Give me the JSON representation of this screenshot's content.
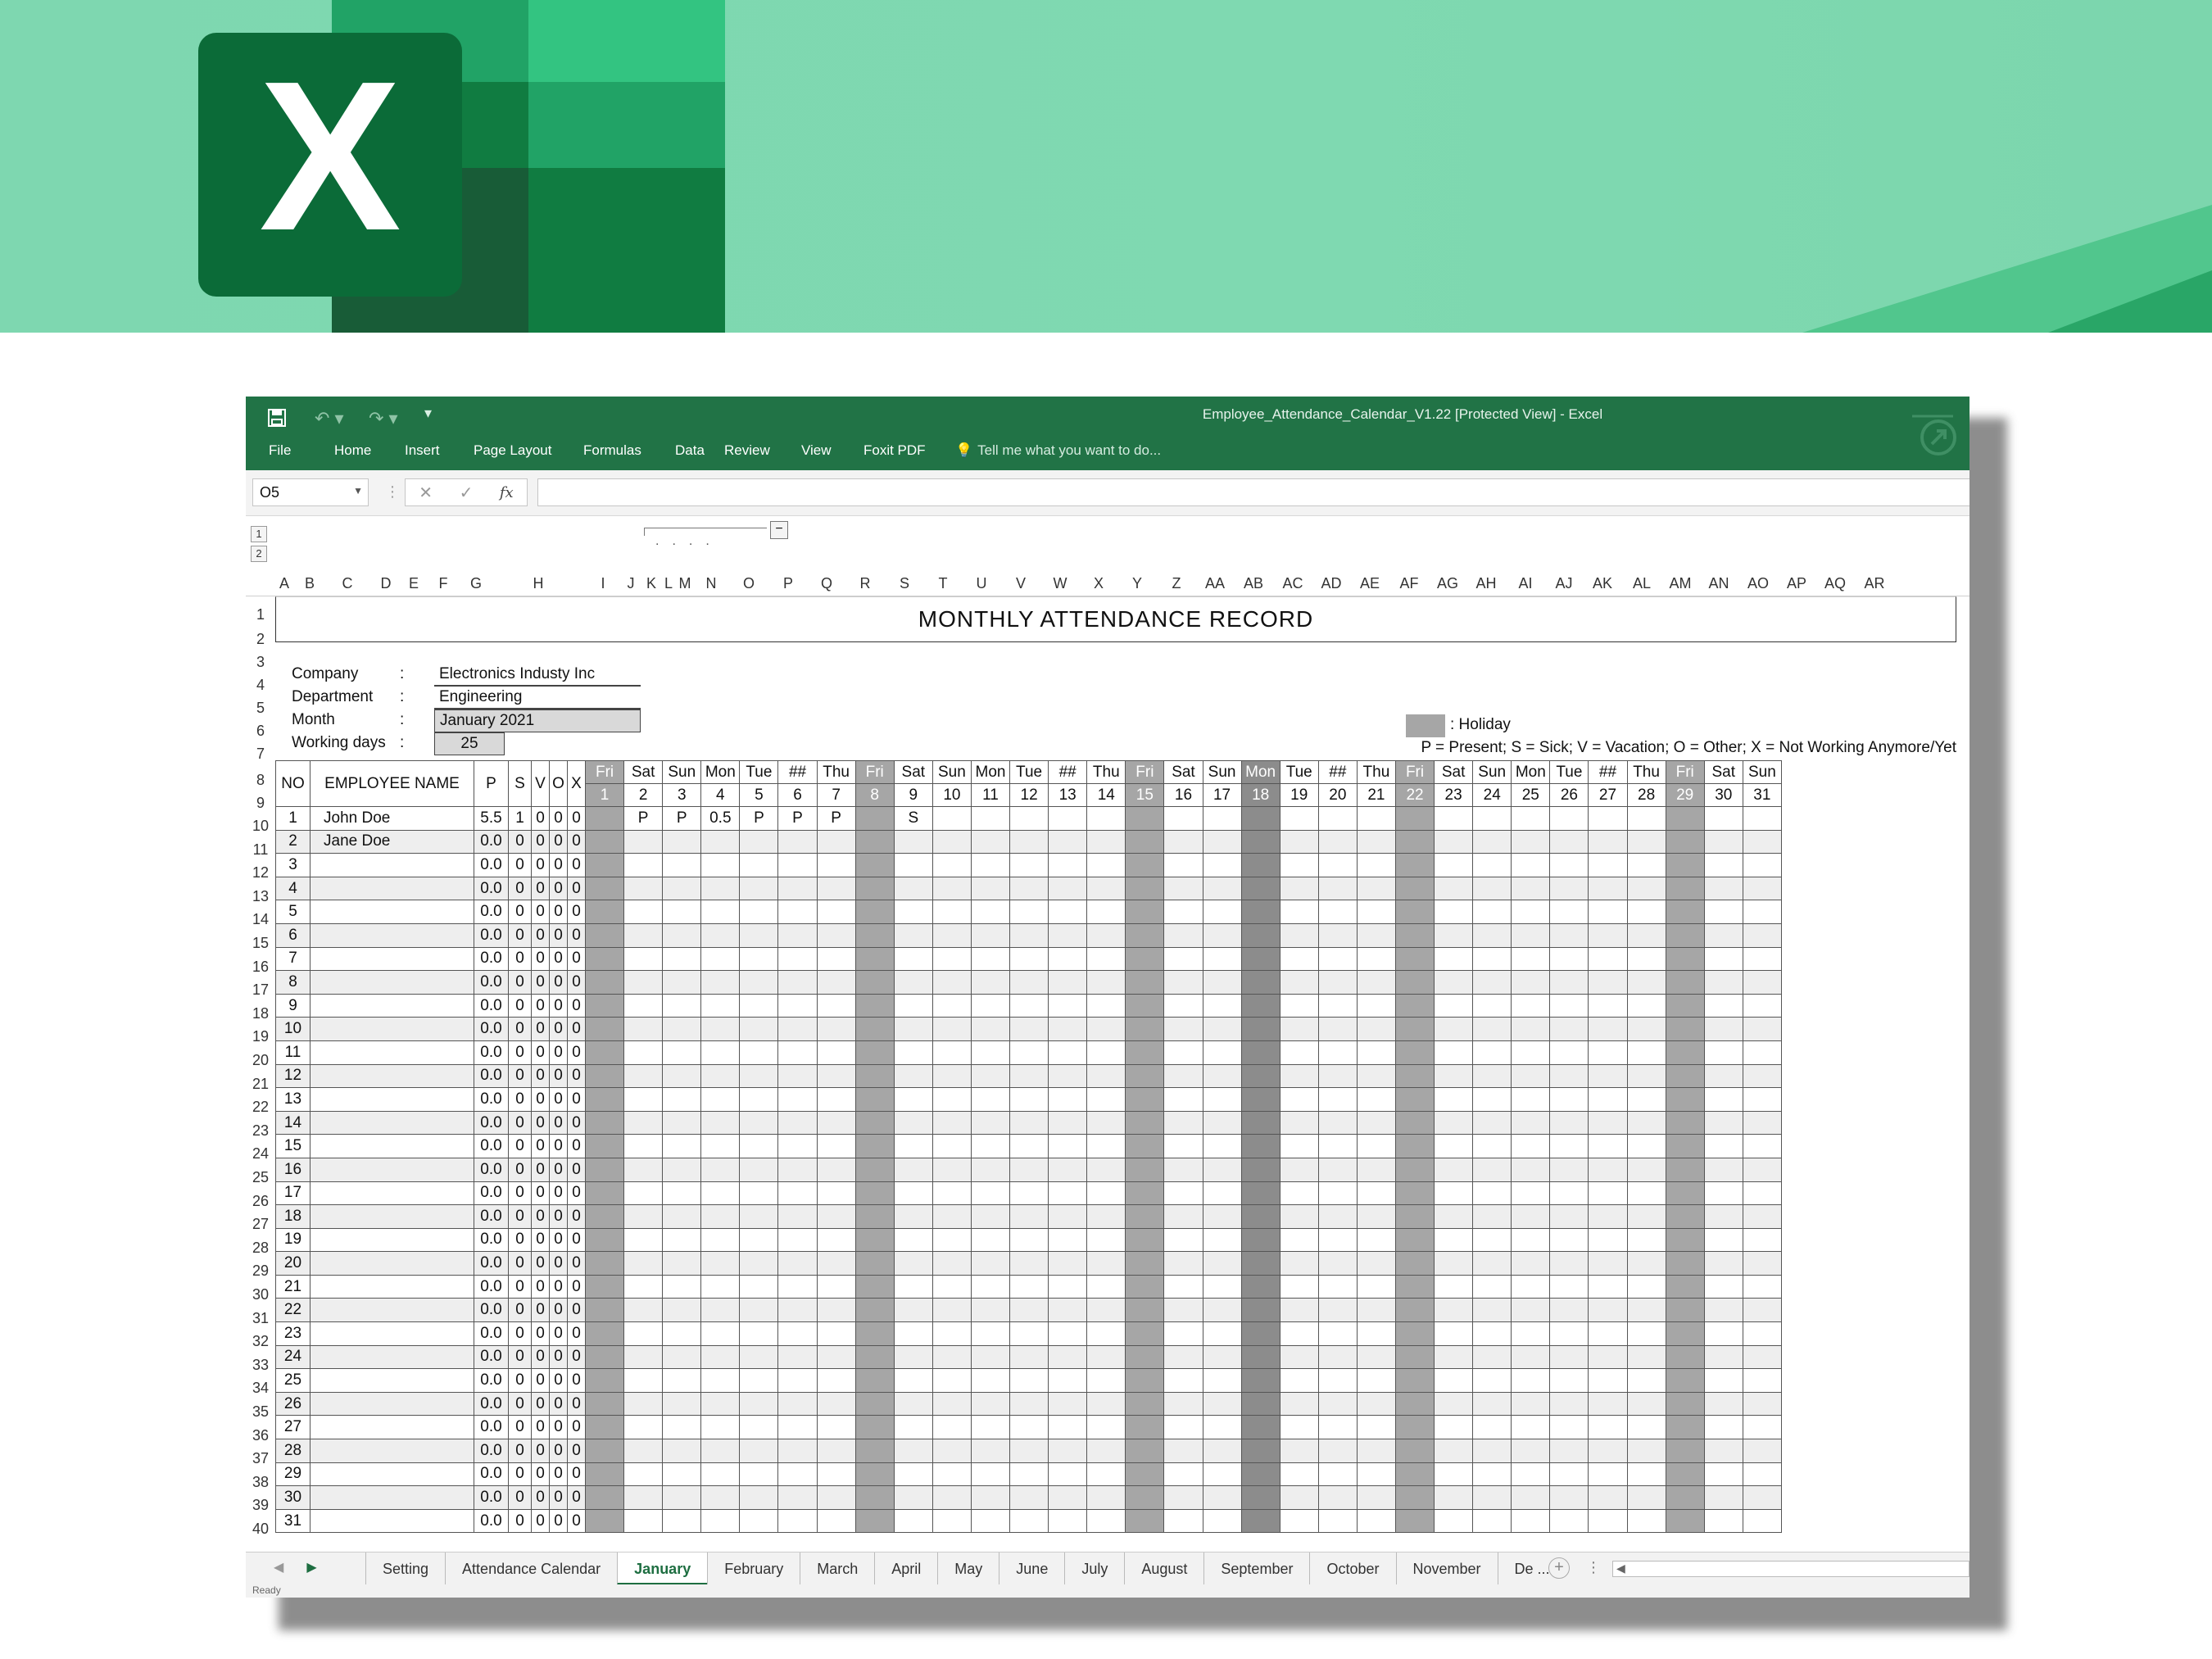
{
  "banner": {
    "logo_letter": "X"
  },
  "titlebar": {
    "title": "Employee_Attendance_Calendar_V1.22  [Protected View] - Excel",
    "tabs": [
      "File",
      "Home",
      "Insert",
      "Page Layout",
      "Formulas",
      "Data",
      "Review",
      "View",
      "Foxit PDF"
    ],
    "tellme": "Tell me what you want to do...",
    "icons": [
      "save-icon",
      "undo-icon",
      "redo-icon",
      "customize-qat-icon",
      "lightbulb-icon"
    ]
  },
  "formulabar": {
    "namebox": "O5",
    "cancel": "✕",
    "enter": "✓",
    "fx": "fx",
    "value": ""
  },
  "outline": {
    "level1": "1",
    "level2": "2",
    "collapse": "−"
  },
  "columns": [
    "A",
    "B",
    "C",
    "D",
    "E",
    "F",
    "G",
    "H",
    "I",
    "J",
    "K",
    "L",
    "M",
    "N",
    "O",
    "P",
    "Q",
    "R",
    "S",
    "T",
    "U",
    "V",
    "W",
    "X",
    "Y",
    "Z",
    "AA",
    "AB",
    "AC",
    "AD",
    "AE",
    "AF",
    "AG",
    "AH",
    "AI",
    "AJ",
    "AK",
    "AL",
    "AM",
    "AN",
    "AO",
    "AP",
    "AQ",
    "AR"
  ],
  "rows": [
    "1",
    "2",
    "3",
    "4",
    "5",
    "6",
    "7",
    "8",
    "9",
    "10",
    "11",
    "12",
    "13",
    "14",
    "15",
    "16",
    "17",
    "18",
    "19",
    "20",
    "21",
    "22",
    "23",
    "24",
    "25",
    "26",
    "27",
    "28",
    "29",
    "30",
    "31",
    "32",
    "33",
    "34",
    "35",
    "36",
    "37",
    "38",
    "39",
    "40"
  ],
  "sheet": {
    "title": "MONTHLY ATTENDANCE RECORD",
    "info": [
      {
        "label": "Company",
        "colon": ":",
        "value": "Electronics Industy Inc"
      },
      {
        "label": "Department",
        "colon": ":",
        "value": "Engineering"
      },
      {
        "label": "Month",
        "colon": ":",
        "value": "January  2021"
      },
      {
        "label": "Working days",
        "colon": ":",
        "value": "25"
      }
    ],
    "legend_holiday": ": Holiday",
    "legend_codes": "P = Present; S = Sick;  V = Vacation; O = Other; X = Not Working Anymore/Yet",
    "colors": {
      "holiday": "#a6a6a6",
      "holiday_dark": "#8c8c8c",
      "accent": "#217346"
    }
  },
  "table": {
    "headers": {
      "no": "NO",
      "name": "EMPLOYEE NAME",
      "p": "P",
      "s": "S",
      "v": "V",
      "o": "O",
      "x": "X"
    },
    "days": [
      {
        "dow": "Fri",
        "d": "1",
        "hol": true
      },
      {
        "dow": "Sat",
        "d": "2"
      },
      {
        "dow": "Sun",
        "d": "3"
      },
      {
        "dow": "Mon",
        "d": "4"
      },
      {
        "dow": "Tue",
        "d": "5"
      },
      {
        "dow": "##",
        "d": "6"
      },
      {
        "dow": "Thu",
        "d": "7"
      },
      {
        "dow": "Fri",
        "d": "8",
        "hol": true
      },
      {
        "dow": "Sat",
        "d": "9"
      },
      {
        "dow": "Sun",
        "d": "10"
      },
      {
        "dow": "Mon",
        "d": "11"
      },
      {
        "dow": "Tue",
        "d": "12"
      },
      {
        "dow": "##",
        "d": "13"
      },
      {
        "dow": "Thu",
        "d": "14"
      },
      {
        "dow": "Fri",
        "d": "15",
        "hol": true
      },
      {
        "dow": "Sat",
        "d": "16"
      },
      {
        "dow": "Sun",
        "d": "17"
      },
      {
        "dow": "Mon",
        "d": "18",
        "hol": true,
        "dark": true
      },
      {
        "dow": "Tue",
        "d": "19"
      },
      {
        "dow": "##",
        "d": "20"
      },
      {
        "dow": "Thu",
        "d": "21"
      },
      {
        "dow": "Fri",
        "d": "22",
        "hol": true
      },
      {
        "dow": "Sat",
        "d": "23"
      },
      {
        "dow": "Sun",
        "d": "24"
      },
      {
        "dow": "Mon",
        "d": "25"
      },
      {
        "dow": "Tue",
        "d": "26"
      },
      {
        "dow": "##",
        "d": "27"
      },
      {
        "dow": "Thu",
        "d": "28"
      },
      {
        "dow": "Fri",
        "d": "29",
        "hol": true
      },
      {
        "dow": "Sat",
        "d": "30"
      },
      {
        "dow": "Sun",
        "d": "31"
      }
    ],
    "employees": [
      {
        "no": "1",
        "name": "John Doe",
        "p": "5.5",
        "s": "1",
        "v": "0",
        "o": "0",
        "x": "0",
        "marks": {
          "2": "P",
          "3": "P",
          "4": "0.5",
          "5": "P",
          "6": "P",
          "7": "P",
          "9": "S"
        }
      },
      {
        "no": "2",
        "name": "Jane Doe",
        "p": "0.0",
        "s": "0",
        "v": "0",
        "o": "0",
        "x": "0"
      },
      {
        "no": "3",
        "name": "",
        "p": "0.0",
        "s": "0",
        "v": "0",
        "o": "0",
        "x": "0"
      },
      {
        "no": "4",
        "name": "",
        "p": "0.0",
        "s": "0",
        "v": "0",
        "o": "0",
        "x": "0"
      },
      {
        "no": "5",
        "name": "",
        "p": "0.0",
        "s": "0",
        "v": "0",
        "o": "0",
        "x": "0"
      },
      {
        "no": "6",
        "name": "",
        "p": "0.0",
        "s": "0",
        "v": "0",
        "o": "0",
        "x": "0"
      },
      {
        "no": "7",
        "name": "",
        "p": "0.0",
        "s": "0",
        "v": "0",
        "o": "0",
        "x": "0"
      },
      {
        "no": "8",
        "name": "",
        "p": "0.0",
        "s": "0",
        "v": "0",
        "o": "0",
        "x": "0"
      },
      {
        "no": "9",
        "name": "",
        "p": "0.0",
        "s": "0",
        "v": "0",
        "o": "0",
        "x": "0"
      },
      {
        "no": "10",
        "name": "",
        "p": "0.0",
        "s": "0",
        "v": "0",
        "o": "0",
        "x": "0"
      },
      {
        "no": "11",
        "name": "",
        "p": "0.0",
        "s": "0",
        "v": "0",
        "o": "0",
        "x": "0"
      },
      {
        "no": "12",
        "name": "",
        "p": "0.0",
        "s": "0",
        "v": "0",
        "o": "0",
        "x": "0"
      },
      {
        "no": "13",
        "name": "",
        "p": "0.0",
        "s": "0",
        "v": "0",
        "o": "0",
        "x": "0"
      },
      {
        "no": "14",
        "name": "",
        "p": "0.0",
        "s": "0",
        "v": "0",
        "o": "0",
        "x": "0"
      },
      {
        "no": "15",
        "name": "",
        "p": "0.0",
        "s": "0",
        "v": "0",
        "o": "0",
        "x": "0"
      },
      {
        "no": "16",
        "name": "",
        "p": "0.0",
        "s": "0",
        "v": "0",
        "o": "0",
        "x": "0"
      },
      {
        "no": "17",
        "name": "",
        "p": "0.0",
        "s": "0",
        "v": "0",
        "o": "0",
        "x": "0"
      },
      {
        "no": "18",
        "name": "",
        "p": "0.0",
        "s": "0",
        "v": "0",
        "o": "0",
        "x": "0"
      },
      {
        "no": "19",
        "name": "",
        "p": "0.0",
        "s": "0",
        "v": "0",
        "o": "0",
        "x": "0"
      },
      {
        "no": "20",
        "name": "",
        "p": "0.0",
        "s": "0",
        "v": "0",
        "o": "0",
        "x": "0"
      },
      {
        "no": "21",
        "name": "",
        "p": "0.0",
        "s": "0",
        "v": "0",
        "o": "0",
        "x": "0"
      },
      {
        "no": "22",
        "name": "",
        "p": "0.0",
        "s": "0",
        "v": "0",
        "o": "0",
        "x": "0"
      },
      {
        "no": "23",
        "name": "",
        "p": "0.0",
        "s": "0",
        "v": "0",
        "o": "0",
        "x": "0"
      },
      {
        "no": "24",
        "name": "",
        "p": "0.0",
        "s": "0",
        "v": "0",
        "o": "0",
        "x": "0"
      },
      {
        "no": "25",
        "name": "",
        "p": "0.0",
        "s": "0",
        "v": "0",
        "o": "0",
        "x": "0"
      },
      {
        "no": "26",
        "name": "",
        "p": "0.0",
        "s": "0",
        "v": "0",
        "o": "0",
        "x": "0"
      },
      {
        "no": "27",
        "name": "",
        "p": "0.0",
        "s": "0",
        "v": "0",
        "o": "0",
        "x": "0"
      },
      {
        "no": "28",
        "name": "",
        "p": "0.0",
        "s": "0",
        "v": "0",
        "o": "0",
        "x": "0"
      },
      {
        "no": "29",
        "name": "",
        "p": "0.0",
        "s": "0",
        "v": "0",
        "o": "0",
        "x": "0"
      },
      {
        "no": "30",
        "name": "",
        "p": "0.0",
        "s": "0",
        "v": "0",
        "o": "0",
        "x": "0"
      },
      {
        "no": "31",
        "name": "",
        "p": "0.0",
        "s": "0",
        "v": "0",
        "o": "0",
        "x": "0"
      }
    ]
  },
  "sheet_tabs": {
    "tabs": [
      "Setting",
      "Attendance Calendar",
      "January",
      "February",
      "March",
      "April",
      "May",
      "June",
      "July",
      "August",
      "September",
      "October",
      "November",
      "De ..."
    ],
    "active": "January",
    "add": "+",
    "more": "⋮"
  },
  "status": {
    "text": "Ready"
  }
}
